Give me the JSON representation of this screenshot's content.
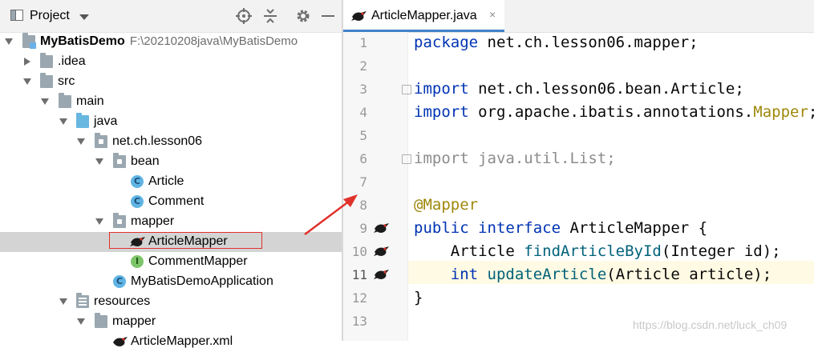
{
  "project_panel": {
    "title": "Project",
    "tree": [
      {
        "label": "MyBatisDemo",
        "path": "F:\\20210208java\\MyBatisDemo"
      },
      {
        "label": ".idea"
      },
      {
        "label": "src"
      },
      {
        "label": "main"
      },
      {
        "label": "java"
      },
      {
        "label": "net.ch.lesson06"
      },
      {
        "label": "bean"
      },
      {
        "label": "Article"
      },
      {
        "label": "Comment"
      },
      {
        "label": "mapper"
      },
      {
        "label": "ArticleMapper"
      },
      {
        "label": "CommentMapper"
      },
      {
        "label": "MyBatisDemoApplication"
      },
      {
        "label": "resources"
      },
      {
        "label": "mapper"
      },
      {
        "label": "ArticleMapper.xml"
      }
    ]
  },
  "editor": {
    "tab": {
      "label": "ArticleMapper.java",
      "close": "×"
    },
    "line_numbers": [
      "1",
      "2",
      "3",
      "4",
      "5",
      "6",
      "7",
      "8",
      "9",
      "10",
      "11",
      "12",
      "13"
    ],
    "current_line": "11",
    "code": {
      "l1_kw": "package",
      "l1_rest": " net.ch.lesson06.mapper;",
      "l3_kw": "import",
      "l3_rest": " net.ch.lesson06.bean.Article;",
      "l4_kw": "import",
      "l4_rest": " org.apache.ibatis.annotations.",
      "l4_ann": "Mapper",
      "l4_end": ";",
      "l6": "import java.util.List;",
      "l8": "@Mapper",
      "l9_kw1": "public",
      "l9_kw2": "interface",
      "l9_rest": " ArticleMapper {",
      "l10_type": "    Article ",
      "l10_fn": "findArticleById",
      "l10_rest": "(Integer id);",
      "l11_kw": "int",
      "l11_fn": "updateArticle",
      "l11_rest": "(Article article);",
      "l12": "}"
    }
  },
  "watermark": "https://blog.csdn.net/luck_ch09",
  "colors": {
    "keyword": "#0033b3",
    "annotation": "#9e880d",
    "method": "#00627a",
    "highlight_box": "#e0322c"
  }
}
